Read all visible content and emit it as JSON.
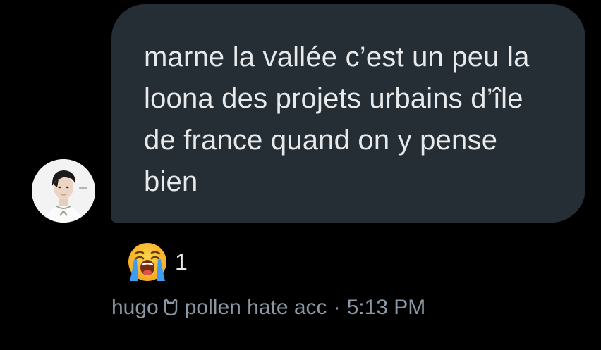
{
  "conversation": {
    "message": {
      "text": "marne la vallée c’est un peu la loona des projets urbains d’île de france quand on y pense bien",
      "avatar_icon": "user-avatar-photo",
      "bubble_color": "#252d35"
    },
    "reaction": {
      "emoji_icon": "loudly-crying-face-icon",
      "count": "1"
    },
    "meta": {
      "sender_name": "hugo",
      "sender_badge_icon": "bear-face-outline-icon",
      "sender_suffix": "pollen hate acc",
      "separator": "·",
      "timestamp": "5:13 PM",
      "text_color": "#8b98a5"
    }
  }
}
